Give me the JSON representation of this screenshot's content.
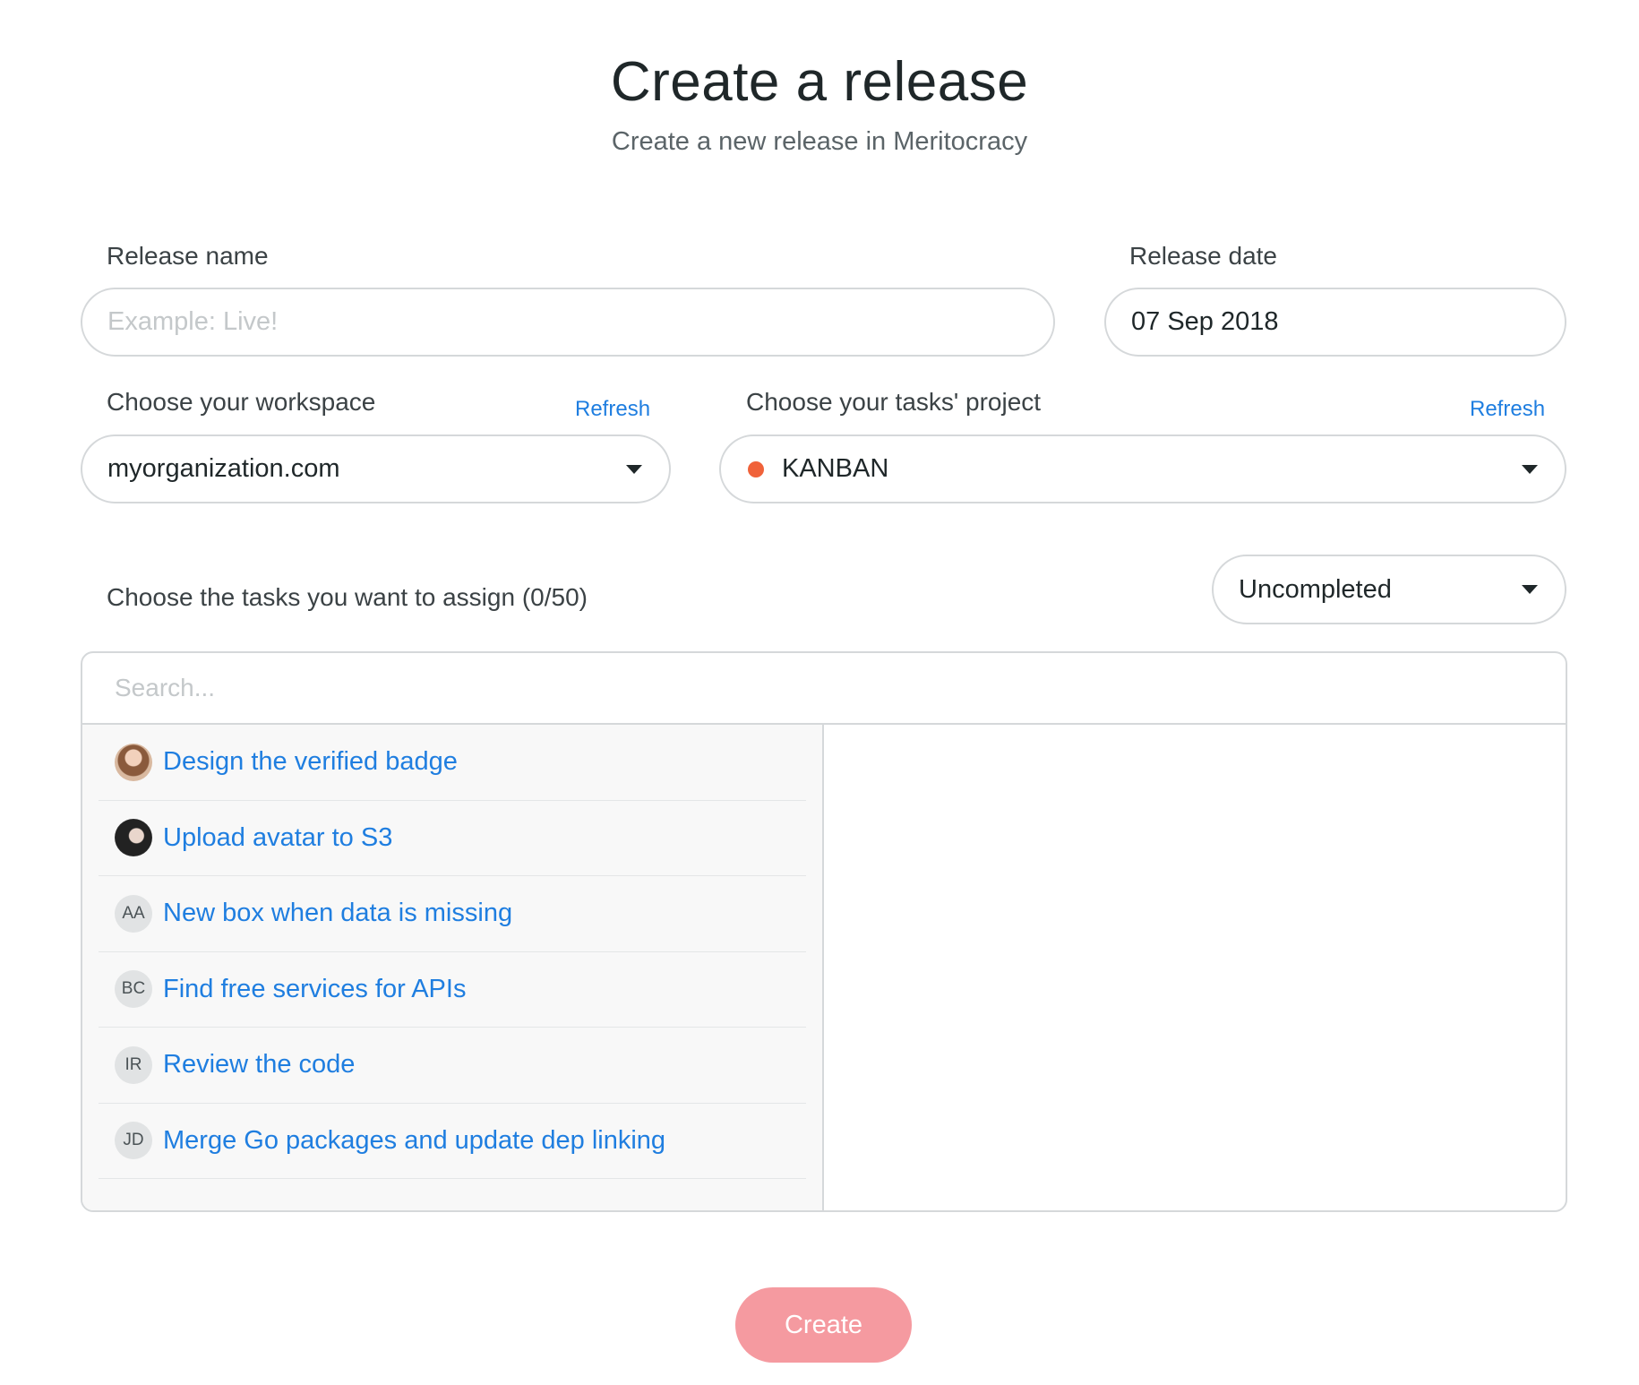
{
  "header": {
    "title": "Create a release",
    "subtitle": "Create a new release in Meritocracy"
  },
  "release_name": {
    "label": "Release name",
    "placeholder": "Example: Live!",
    "value": ""
  },
  "release_date": {
    "label": "Release date",
    "value": "07 Sep 2018"
  },
  "workspace": {
    "label": "Choose your workspace",
    "refresh_label": "Refresh",
    "selected": "myorganization.com"
  },
  "project": {
    "label": "Choose your tasks' project",
    "refresh_label": "Refresh",
    "selected": "KANBAN",
    "dot_color": "#f0623a"
  },
  "tasks": {
    "label": "Choose the tasks you want to assign (0/50)",
    "filter": "Uncompleted",
    "search_placeholder": "Search...",
    "items": [
      {
        "title": "Design the verified badge",
        "avatar": "photo",
        "initials": ""
      },
      {
        "title": "Upload avatar to S3",
        "avatar": "photo",
        "initials": ""
      },
      {
        "title": "New box when data is missing",
        "avatar": "initials",
        "initials": "AA"
      },
      {
        "title": "Find free services for APIs",
        "avatar": "initials",
        "initials": "BC"
      },
      {
        "title": "Review the code",
        "avatar": "initials",
        "initials": "IR"
      },
      {
        "title": "Merge Go packages and update dep linking",
        "avatar": "initials",
        "initials": "JD"
      }
    ]
  },
  "actions": {
    "create_label": "Create"
  },
  "colors": {
    "accent_link": "#1f7ee0",
    "create_button": "#f59aa0",
    "border": "#d5d8da"
  }
}
